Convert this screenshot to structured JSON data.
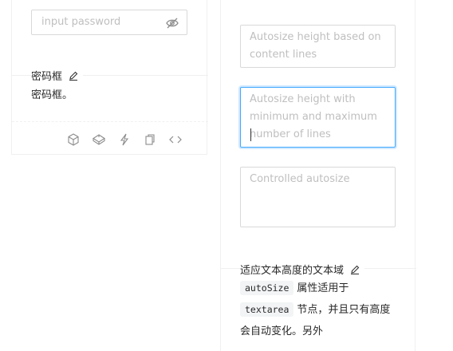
{
  "password_demo": {
    "password_placeholder": "input password",
    "title": "密码框",
    "description": "密码框。",
    "actions": [
      "codesandbox-icon",
      "codepen-icon",
      "thunderbolt-icon",
      "copy-icon",
      "code-icon"
    ]
  },
  "autosize_demo": {
    "textarea1_placeholder": "Autosize height based on content lines",
    "textarea2_placeholder": "Autosize height with minimum and maximum number of lines",
    "textarea3_placeholder": "Controlled autosize",
    "title": "适应文本高度的文本域",
    "code1": "autoSize",
    "text1": "属性适用于",
    "code2": "textarea",
    "text2": "节点，并且只有高度会自动变化。另外"
  },
  "colors": {
    "border": "#d9d9d9",
    "focus": "#40a9ff",
    "placeholder": "#bfbfbf"
  }
}
